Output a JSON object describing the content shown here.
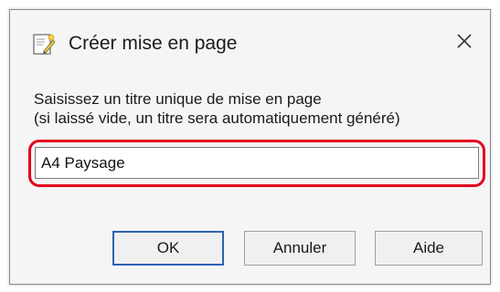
{
  "dialog": {
    "title": "Créer mise en page",
    "icon": "layout-page-icon",
    "close_icon": "close-icon",
    "instruction_line1": "Saisissez un titre unique de mise en page",
    "instruction_line2": "(si laissé vide, un titre sera automatiquement généré)",
    "input_value": "A4 Paysage",
    "highlight_color": "#e3001b",
    "buttons": {
      "ok": "OK",
      "cancel": "Annuler",
      "help": "Aide"
    }
  }
}
